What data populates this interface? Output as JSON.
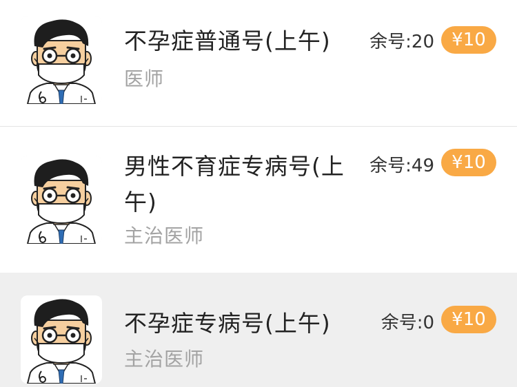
{
  "rows": [
    {
      "title": "不孕症普通号(上午)",
      "title_lines": [
        "不孕症普通号(上午)"
      ],
      "doctor_title": "医师",
      "remaining": "余号:20",
      "price": "¥10",
      "highlighted": false
    },
    {
      "title": "男性不育症专病号(上午)",
      "title_lines": [
        "男性不育症专病号(上",
        "午)"
      ],
      "doctor_title": "主治医师",
      "remaining": "余号:49",
      "price": "¥10",
      "highlighted": false
    },
    {
      "title": "不孕症专病号(上午)",
      "title_lines": [
        "不孕症专病号(上午)"
      ],
      "doctor_title": "主治医师",
      "remaining": "余号:0",
      "price": "¥10",
      "highlighted": true
    }
  ],
  "colors": {
    "accent": "#f9a945",
    "highlight_bg": "#efefef",
    "subtitle": "#a3a3a3"
  },
  "icons": {
    "avatar": "doctor-avatar-icon"
  }
}
